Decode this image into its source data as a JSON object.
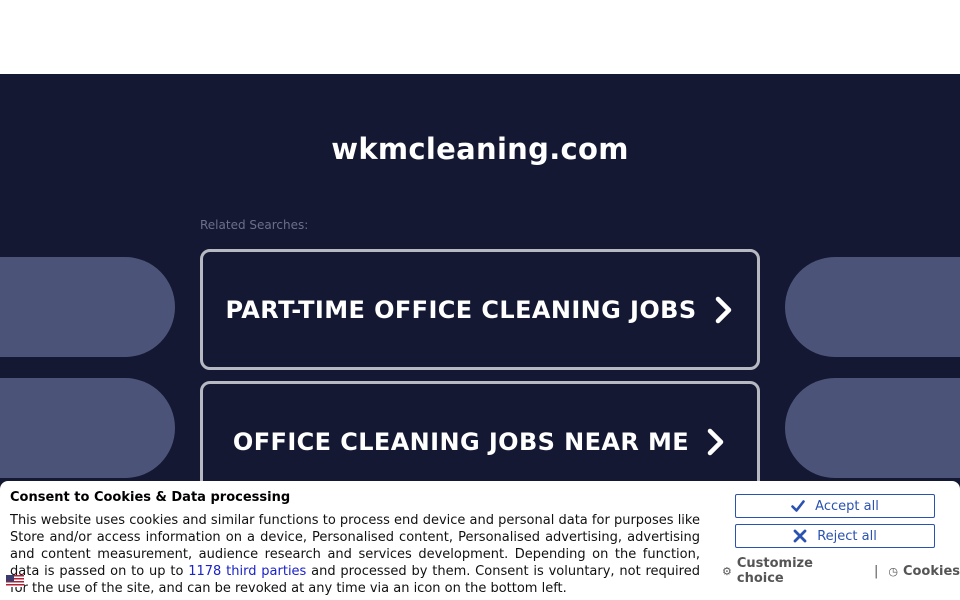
{
  "page": {
    "domain": "wkmcleaning.com",
    "related_label": "Related Searches:"
  },
  "searches": [
    {
      "label": "PART-TIME OFFICE CLEANING JOBS"
    },
    {
      "label": "OFFICE CLEANING JOBS NEAR ME"
    }
  ],
  "consent": {
    "title": "Consent to Cookies & Data processing",
    "text_before": "This website uses cookies and similar functions to process end device and personal data for purposes like Store and/or access information on a device, Personalised content, Personalised advertising, advertising and content measurement, audience research and services development. Depending on the function, data is passed on to up to ",
    "third_parties_link": "1178 third parties",
    "text_after": " and processed by them. Consent is voluntary, not required for the use of the site, and can be revoked at any time via an icon on the bottom left.",
    "accept_label": "Accept all",
    "reject_label": "Reject all",
    "customize_label": "Customize choice",
    "cookies_label": "Cookies",
    "separator": "|"
  },
  "colors": {
    "background": "#141833",
    "pill": "#4b5478",
    "card_border": "#b7b9c2",
    "button_accent": "#2a52b0",
    "link": "#1a22c8"
  },
  "icons": {
    "chevron": "chevron-right-icon",
    "accept": "check-icon",
    "reject": "x-icon",
    "customize": "gear-icon",
    "cookies": "cookie-icon",
    "language": "flag-icon"
  }
}
